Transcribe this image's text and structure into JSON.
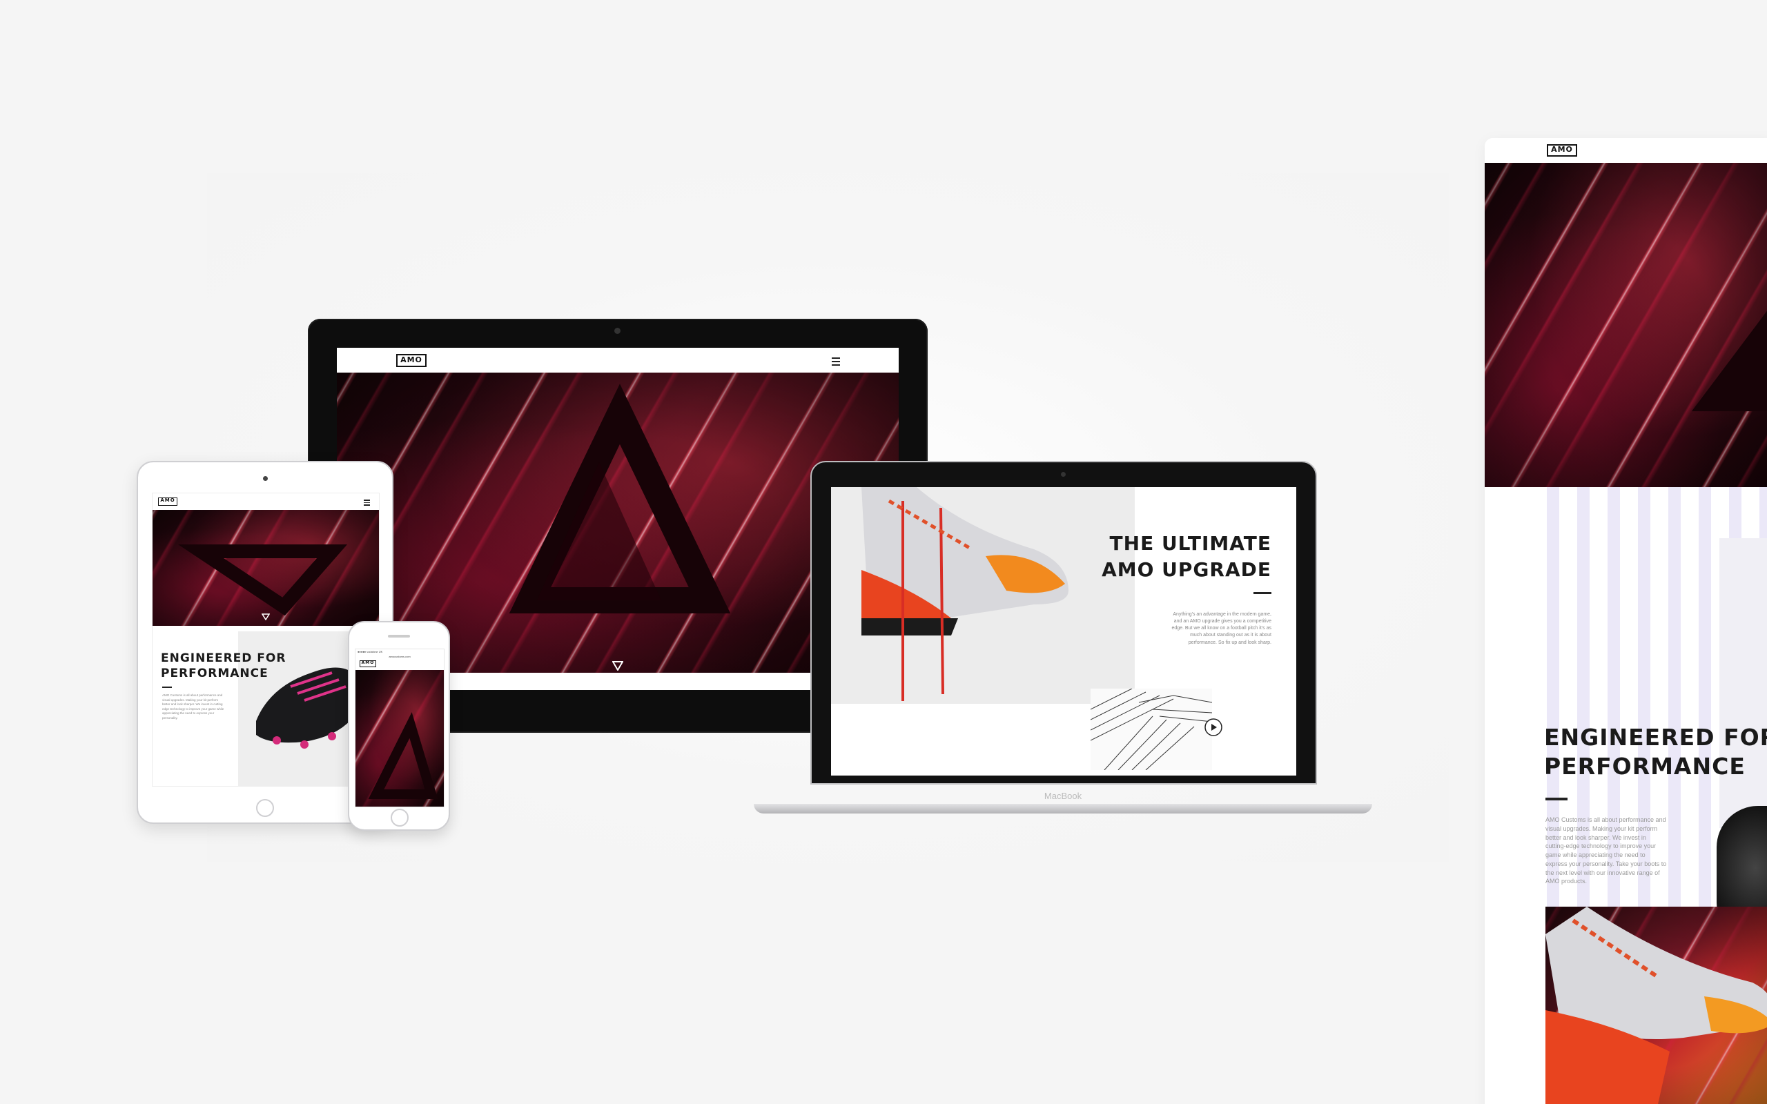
{
  "brand": {
    "logo_text": "AMO"
  },
  "colors": {
    "accent_red": "#e0203a",
    "dark": "#1a1a1a",
    "stripe_lavender": "#ebe8f8",
    "background": "#f4f4f4"
  },
  "desktop": {
    "menu_icon": "hamburger-menu-icon",
    "scroll_icon": "down-triangle-icon"
  },
  "laptop": {
    "headline_line1": "THE ULTIMATE",
    "headline_line2": "AMO UPGRADE",
    "body": "Anything's an advantage in the modern game, and an AMO upgrade gives you a competitive edge. But we all know on a football pitch it's as much about standing out as it is about performance. So fix up and look sharp.",
    "play_icon": "play-circle-icon",
    "brand_label": "MacBook"
  },
  "tablet": {
    "headline_line1": "ENGINEERED FOR",
    "headline_line2": "PERFORMANCE",
    "body": "AMO Customs is all about performance and visual upgrades. Making your kit perform better and look sharper. We invest in cutting edge technology to improve your game while appreciating the need to express your personality."
  },
  "phone": {
    "status_text": "●●●●● vodafone UK",
    "url_text": "amocustoms.com"
  },
  "page": {
    "headline_line1": "ENGINEERED FOR",
    "headline_line2": "PERFORMANCE",
    "body": "AMO Customs is all about performance and visual upgrades. Making your kit perform better and look sharper. We invest in cutting-edge technology to improve your game while appreciating the need to express your personality. Take your boots to the next level with our innovative range of AMO products."
  }
}
